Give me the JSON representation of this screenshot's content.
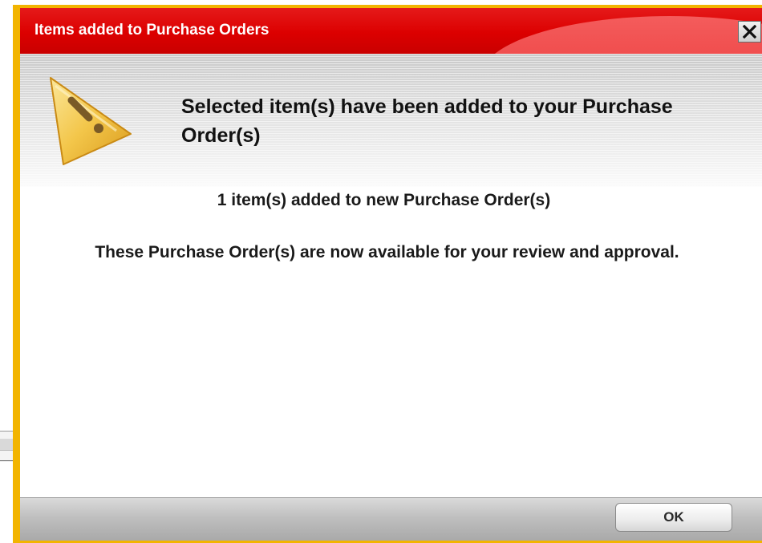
{
  "dialog": {
    "title": "Items added to Purchase Orders",
    "close_icon": "close-icon",
    "warning_icon": "warning-triangle-icon",
    "header_message": "Selected item(s) have been added to your Purchase Order(s)",
    "added_count_text": "1 item(s) added to new Purchase Order(s)",
    "review_text": "These Purchase Order(s) are now available for your review and approval.",
    "ok_label": "OK"
  },
  "colors": {
    "frame": "#f2b400",
    "titlebar": "#dc0000",
    "warning_icon": "#f0c040"
  }
}
